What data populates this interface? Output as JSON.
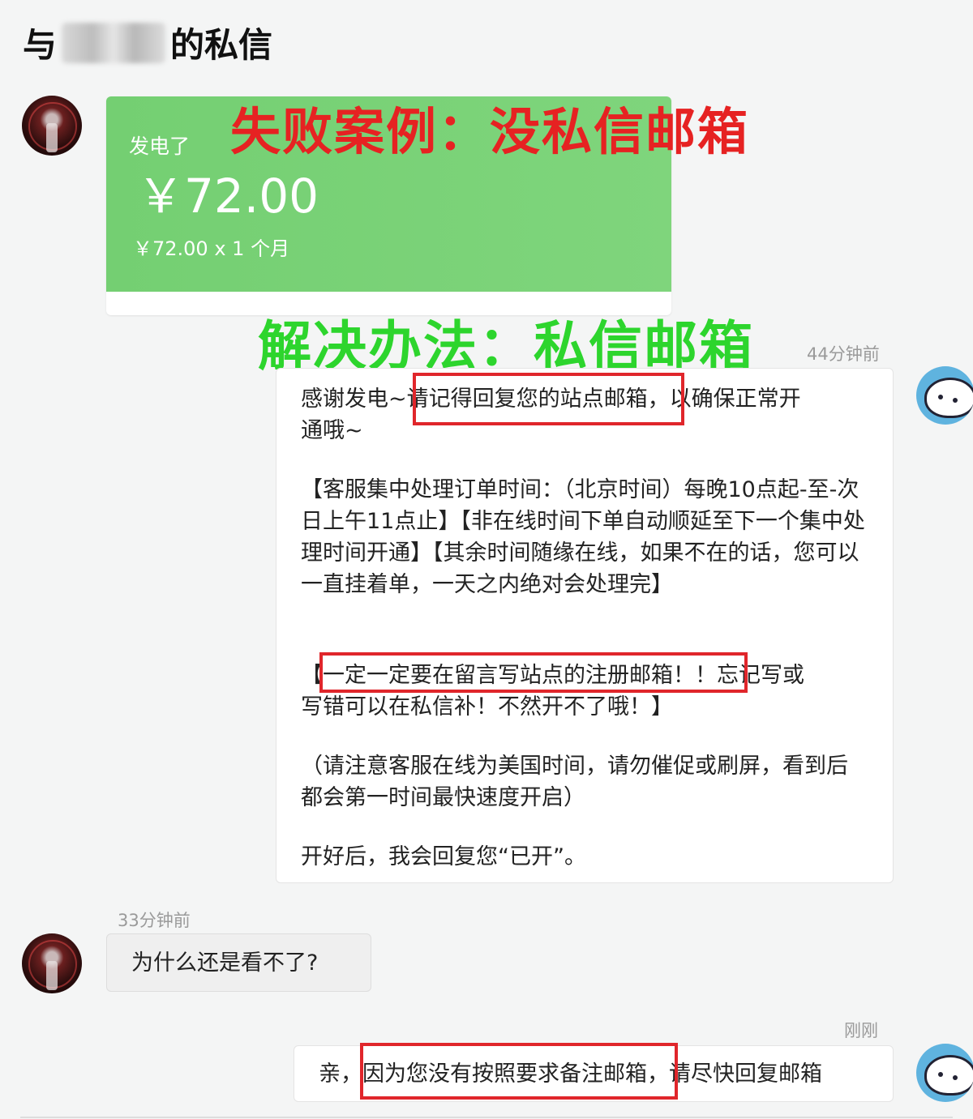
{
  "header": {
    "title_prefix": "与",
    "title_suffix": "的私信"
  },
  "payment_card": {
    "label": "发电了",
    "amount": "￥72.00",
    "detail": "￥72.00 x 1 个月",
    "color": "#76d174"
  },
  "annotations": {
    "failure_caption": "失败案例：没私信邮箱",
    "solution_caption": "解决办法：私信邮箱",
    "failure_color": "#e62222",
    "solution_color": "#2dd52d",
    "highlight_color": "#e0262b"
  },
  "messages": {
    "auto_reply": {
      "time": "44分钟前",
      "line1_before": "感谢发电~",
      "line1_highlight": "请记得回复您的站点邮箱",
      "line1_after": "，以确保正常开",
      "line2": "通哦~",
      "para2": "【客服集中处理订单时间：（北京时间）每晚10点起-至-次日上午11点止】【非在线时间下单自动顺延至下一个集中处理时间开通】【其余时间随缘在线，如果不在的话，您可以一直挂着单，一天之内绝对会处理完】",
      "para3_open": "【",
      "para3_highlight": "一定一定要在留言写站点的注册邮箱！！",
      "para3_after": "忘记写或",
      "para3_line2": "写错可以在私信补！不然开不了哦！】",
      "para4": "（请注意客服在线为美国时间，请勿催促或刷屏，看到后都会第一时间最快速度开启）",
      "para5": "开好后，我会回复您“已开”。"
    },
    "user_question": {
      "time": "33分钟前",
      "text": "为什么还是看不了?"
    },
    "final_reply": {
      "time": "刚刚",
      "before": "亲，",
      "highlight": "因为您没有按照要求备注邮箱",
      "after": "，请尽快回复邮箱"
    }
  }
}
